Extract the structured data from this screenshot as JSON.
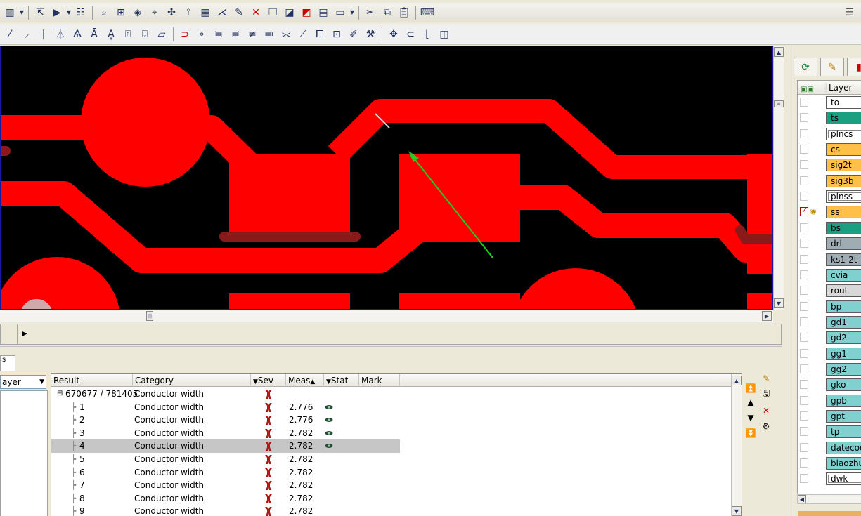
{
  "toolbar_top": {
    "icons": [
      "layout-icon",
      "pointer-icon",
      "play-icon",
      "list-icon",
      "zoom-icon",
      "zoom-area-icon",
      "view-icon",
      "query-icon",
      "select-icon",
      "route-icon",
      "grid-icon",
      "net-icon",
      "edit-icon",
      "cut-icon",
      "copy-icon",
      "shape-icon",
      "drc-icon",
      "attach-icon",
      "props-icon",
      "close-x-icon",
      "copy2-icon",
      "paste-icon",
      "keyboard-icon"
    ]
  },
  "toolbar_second": {
    "icons": [
      "slash-icon",
      "pen-icon",
      "bar-icon",
      "align-icon",
      "text-a-icon",
      "text-a2-icon",
      "text-a3-icon",
      "box-up-icon",
      "box-down-icon",
      "para-icon",
      "magnet-icon",
      "dot-icon",
      "line1-icon",
      "line2-icon",
      "line3-icon",
      "line4-icon",
      "line5-icon",
      "brush-icon",
      "edit-box-icon",
      "grid-box-icon",
      "note-icon",
      "wand-icon",
      "cross-icon",
      "curve-icon",
      "corner-icon",
      "square-icon"
    ]
  },
  "canvas": {
    "accent_copper": "#ff0000",
    "accent_dark_copper": "#8a1a1a",
    "marker_color": "#22cc22",
    "prev_glyph": "‹"
  },
  "command_line": {
    "prompt_glyph": "▶"
  },
  "bottom_panel": {
    "tab_label": "s",
    "layer_select": "ayer",
    "columns": {
      "result": "Result",
      "category": "Category",
      "sev": "Sev",
      "meas": "Meas",
      "stat": "Stat",
      "mark": "Mark"
    },
    "root": {
      "id": "670677 / 781405",
      "category": "Conductor width"
    },
    "rows": [
      {
        "id": "1",
        "category": "Conductor width",
        "meas": "2.776",
        "stat": true
      },
      {
        "id": "2",
        "category": "Conductor width",
        "meas": "2.776",
        "stat": true
      },
      {
        "id": "3",
        "category": "Conductor width",
        "meas": "2.782",
        "stat": true
      },
      {
        "id": "4",
        "category": "Conductor width",
        "meas": "2.782",
        "stat": true,
        "selected": true
      },
      {
        "id": "5",
        "category": "Conductor width",
        "meas": "2.782",
        "stat": false
      },
      {
        "id": "6",
        "category": "Conductor width",
        "meas": "2.782",
        "stat": false
      },
      {
        "id": "7",
        "category": "Conductor width",
        "meas": "2.782",
        "stat": false
      },
      {
        "id": "8",
        "category": "Conductor width",
        "meas": "2.782",
        "stat": false
      },
      {
        "id": "9",
        "category": "Conductor width",
        "meas": "2.782",
        "stat": false
      }
    ]
  },
  "layer_panel": {
    "header": "Layer",
    "layers": [
      {
        "name": "to",
        "color": "#ffffff",
        "checked": false,
        "inner": false
      },
      {
        "name": "ts",
        "color": "#1aa080",
        "checked": false,
        "inner": false
      },
      {
        "name": "plncs",
        "color": "#ffffff",
        "checked": false,
        "inner": true
      },
      {
        "name": "cs",
        "color": "#ffc04a",
        "checked": false,
        "inner": false
      },
      {
        "name": "sig2t",
        "color": "#ffc04a",
        "checked": false,
        "inner": false
      },
      {
        "name": "sig3b",
        "color": "#ffc04a",
        "checked": false,
        "inner": false
      },
      {
        "name": "plnss",
        "color": "#ffffff",
        "checked": false,
        "inner": true
      },
      {
        "name": "ss",
        "color": "#ffc04a",
        "checked": true,
        "inner": false
      },
      {
        "name": "bs",
        "color": "#1aa080",
        "checked": false,
        "inner": false
      },
      {
        "name": "drl",
        "color": "#a0acb4",
        "checked": false,
        "inner": false
      },
      {
        "name": "ks1-2t",
        "color": "#a0acb4",
        "checked": false,
        "inner": false
      },
      {
        "name": "cvia",
        "color": "#80d0d0",
        "checked": false,
        "inner": false
      },
      {
        "name": "rout",
        "color": "#d8d8d8",
        "checked": false,
        "inner": false
      },
      {
        "name": "bp",
        "color": "#80d0d0",
        "checked": false,
        "inner": false
      },
      {
        "name": "gd1",
        "color": "#80d0d0",
        "checked": false,
        "inner": false
      },
      {
        "name": "gd2",
        "color": "#80d0d0",
        "checked": false,
        "inner": false
      },
      {
        "name": "gg1",
        "color": "#80d0d0",
        "checked": false,
        "inner": false
      },
      {
        "name": "gg2",
        "color": "#80d0d0",
        "checked": false,
        "inner": false
      },
      {
        "name": "gko",
        "color": "#80d0d0",
        "checked": false,
        "inner": false
      },
      {
        "name": "gpb",
        "color": "#80d0d0",
        "checked": false,
        "inner": false
      },
      {
        "name": "gpt",
        "color": "#80d0d0",
        "checked": false,
        "inner": false
      },
      {
        "name": "tp",
        "color": "#80d0d0",
        "checked": false,
        "inner": false
      },
      {
        "name": "datecode",
        "color": "#80d0d0",
        "checked": false,
        "inner": false
      },
      {
        "name": "biaozhu",
        "color": "#80d0d0",
        "checked": false,
        "inner": false
      },
      {
        "name": "dwk",
        "color": "#ffffff",
        "checked": false,
        "inner": true
      }
    ]
  }
}
